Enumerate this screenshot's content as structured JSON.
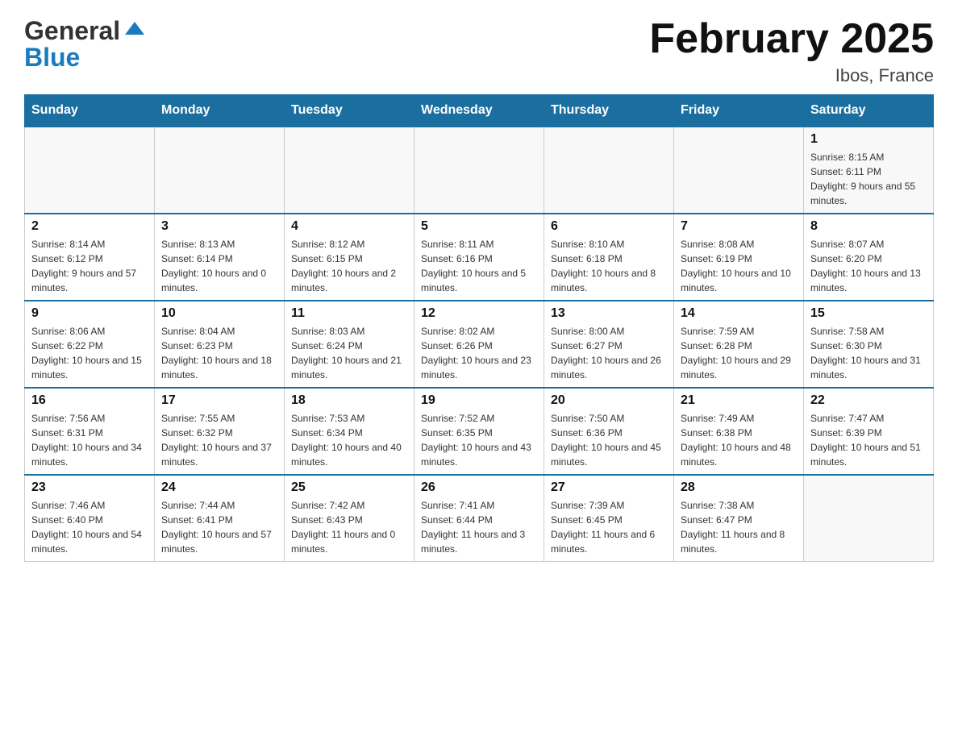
{
  "header": {
    "logo_general": "General",
    "logo_blue": "Blue",
    "month_title": "February 2025",
    "location": "Ibos, France"
  },
  "days_of_week": [
    "Sunday",
    "Monday",
    "Tuesday",
    "Wednesday",
    "Thursday",
    "Friday",
    "Saturday"
  ],
  "weeks": [
    {
      "days": [
        {
          "date": "",
          "info": ""
        },
        {
          "date": "",
          "info": ""
        },
        {
          "date": "",
          "info": ""
        },
        {
          "date": "",
          "info": ""
        },
        {
          "date": "",
          "info": ""
        },
        {
          "date": "",
          "info": ""
        },
        {
          "date": "1",
          "info": "Sunrise: 8:15 AM\nSunset: 6:11 PM\nDaylight: 9 hours and 55 minutes."
        }
      ]
    },
    {
      "days": [
        {
          "date": "2",
          "info": "Sunrise: 8:14 AM\nSunset: 6:12 PM\nDaylight: 9 hours and 57 minutes."
        },
        {
          "date": "3",
          "info": "Sunrise: 8:13 AM\nSunset: 6:14 PM\nDaylight: 10 hours and 0 minutes."
        },
        {
          "date": "4",
          "info": "Sunrise: 8:12 AM\nSunset: 6:15 PM\nDaylight: 10 hours and 2 minutes."
        },
        {
          "date": "5",
          "info": "Sunrise: 8:11 AM\nSunset: 6:16 PM\nDaylight: 10 hours and 5 minutes."
        },
        {
          "date": "6",
          "info": "Sunrise: 8:10 AM\nSunset: 6:18 PM\nDaylight: 10 hours and 8 minutes."
        },
        {
          "date": "7",
          "info": "Sunrise: 8:08 AM\nSunset: 6:19 PM\nDaylight: 10 hours and 10 minutes."
        },
        {
          "date": "8",
          "info": "Sunrise: 8:07 AM\nSunset: 6:20 PM\nDaylight: 10 hours and 13 minutes."
        }
      ]
    },
    {
      "days": [
        {
          "date": "9",
          "info": "Sunrise: 8:06 AM\nSunset: 6:22 PM\nDaylight: 10 hours and 15 minutes."
        },
        {
          "date": "10",
          "info": "Sunrise: 8:04 AM\nSunset: 6:23 PM\nDaylight: 10 hours and 18 minutes."
        },
        {
          "date": "11",
          "info": "Sunrise: 8:03 AM\nSunset: 6:24 PM\nDaylight: 10 hours and 21 minutes."
        },
        {
          "date": "12",
          "info": "Sunrise: 8:02 AM\nSunset: 6:26 PM\nDaylight: 10 hours and 23 minutes."
        },
        {
          "date": "13",
          "info": "Sunrise: 8:00 AM\nSunset: 6:27 PM\nDaylight: 10 hours and 26 minutes."
        },
        {
          "date": "14",
          "info": "Sunrise: 7:59 AM\nSunset: 6:28 PM\nDaylight: 10 hours and 29 minutes."
        },
        {
          "date": "15",
          "info": "Sunrise: 7:58 AM\nSunset: 6:30 PM\nDaylight: 10 hours and 31 minutes."
        }
      ]
    },
    {
      "days": [
        {
          "date": "16",
          "info": "Sunrise: 7:56 AM\nSunset: 6:31 PM\nDaylight: 10 hours and 34 minutes."
        },
        {
          "date": "17",
          "info": "Sunrise: 7:55 AM\nSunset: 6:32 PM\nDaylight: 10 hours and 37 minutes."
        },
        {
          "date": "18",
          "info": "Sunrise: 7:53 AM\nSunset: 6:34 PM\nDaylight: 10 hours and 40 minutes."
        },
        {
          "date": "19",
          "info": "Sunrise: 7:52 AM\nSunset: 6:35 PM\nDaylight: 10 hours and 43 minutes."
        },
        {
          "date": "20",
          "info": "Sunrise: 7:50 AM\nSunset: 6:36 PM\nDaylight: 10 hours and 45 minutes."
        },
        {
          "date": "21",
          "info": "Sunrise: 7:49 AM\nSunset: 6:38 PM\nDaylight: 10 hours and 48 minutes."
        },
        {
          "date": "22",
          "info": "Sunrise: 7:47 AM\nSunset: 6:39 PM\nDaylight: 10 hours and 51 minutes."
        }
      ]
    },
    {
      "days": [
        {
          "date": "23",
          "info": "Sunrise: 7:46 AM\nSunset: 6:40 PM\nDaylight: 10 hours and 54 minutes."
        },
        {
          "date": "24",
          "info": "Sunrise: 7:44 AM\nSunset: 6:41 PM\nDaylight: 10 hours and 57 minutes."
        },
        {
          "date": "25",
          "info": "Sunrise: 7:42 AM\nSunset: 6:43 PM\nDaylight: 11 hours and 0 minutes."
        },
        {
          "date": "26",
          "info": "Sunrise: 7:41 AM\nSunset: 6:44 PM\nDaylight: 11 hours and 3 minutes."
        },
        {
          "date": "27",
          "info": "Sunrise: 7:39 AM\nSunset: 6:45 PM\nDaylight: 11 hours and 6 minutes."
        },
        {
          "date": "28",
          "info": "Sunrise: 7:38 AM\nSunset: 6:47 PM\nDaylight: 11 hours and 8 minutes."
        },
        {
          "date": "",
          "info": ""
        }
      ]
    }
  ]
}
